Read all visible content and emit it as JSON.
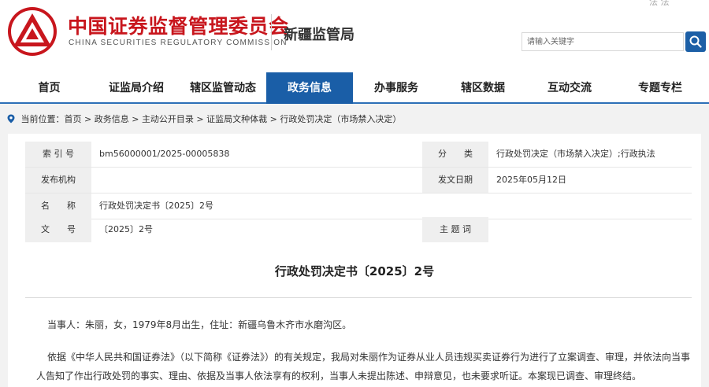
{
  "header": {
    "logo_cn": "中国证券监督管理委员会",
    "logo_en": "CHINA SECURITIES REGULATORY COMMISSION",
    "bureau": "新疆监管局",
    "top_link": "法 法",
    "search_placeholder": "请输入关键字",
    "brand_color": "#c8161d",
    "accent_color": "#1a5ea7"
  },
  "nav": {
    "items": [
      {
        "label": "首页"
      },
      {
        "label": "证监局介绍"
      },
      {
        "label": "辖区监管动态"
      },
      {
        "label": "政务信息",
        "active": true
      },
      {
        "label": "办事服务"
      },
      {
        "label": "辖区数据"
      },
      {
        "label": "互动交流"
      },
      {
        "label": "专题专栏"
      }
    ]
  },
  "breadcrumb": {
    "prefix": "当前位置：",
    "segments": [
      "首页",
      "政务信息",
      "主动公开目录",
      "证监局文种体裁",
      "行政处罚决定（市场禁入决定）"
    ],
    "separator": " > "
  },
  "meta": {
    "index_label": "索 引 号",
    "index_value": "bm56000001/2025-00005838",
    "category_label": "分　　类",
    "category_value": "行政处罚决定（市场禁入决定）;行政执法",
    "publisher_label": "发布机构",
    "publisher_value": "",
    "date_label": "发文日期",
    "date_value": "2025年05月12日",
    "name_label": "名　　称",
    "name_value": "行政处罚决定书〔2025〕2号",
    "number_label": "文　　号",
    "number_value": "〔2025〕2号",
    "keywords_label": "主 题 词",
    "keywords_value": ""
  },
  "document": {
    "title": "行政处罚决定书〔2025〕2号",
    "paragraphs": [
      "当事人：朱丽，女，1979年8月出生，住址：新疆乌鲁木齐市水磨沟区。",
      "依据《中华人民共和国证券法》（以下简称《证券法》）的有关规定，我局对朱丽作为证券从业人员违规买卖证券行为进行了立案调查、审理，并依法向当事人告知了作出行政处罚的事实、理由、依据及当事人依法享有的权利，当事人未提出陈述、申辩意见，也未要求听证。本案现已调查、审理终结。"
    ]
  }
}
